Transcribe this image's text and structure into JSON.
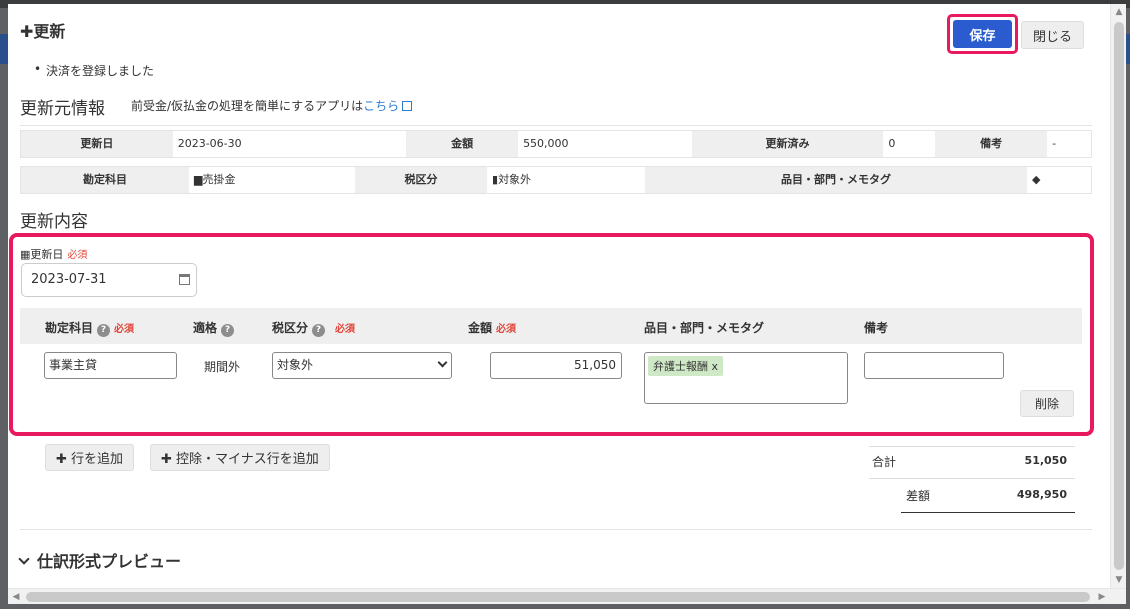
{
  "modal": {
    "title": "✚更新",
    "save_label": "保存",
    "close_label": "閉じる",
    "notice": "決済を登録しました"
  },
  "source": {
    "heading": "更新元情報",
    "promo_text": "前受金/仮払金の処理を簡単にするアプリは",
    "promo_link": "こちら",
    "row1": [
      {
        "label": "更新日",
        "value": "2023-06-30"
      },
      {
        "label": "金額",
        "value": "550,000"
      },
      {
        "label": "更新済み",
        "value": "0"
      },
      {
        "label": "備考",
        "value": "-"
      }
    ],
    "row2": [
      {
        "label": "勘定科目",
        "value": "売掛金"
      },
      {
        "label": "税区分",
        "value": "対象外"
      },
      {
        "label": "品目・部門・メモタグ",
        "value": ""
      }
    ]
  },
  "update": {
    "heading": "更新内容",
    "date_label": "更新日",
    "required": "必須",
    "date_value": "2023-07-31",
    "columns": {
      "account": "勘定科目",
      "summary": "適格",
      "tax": "税区分",
      "amount": "金額",
      "tags": "品目・部門・メモタグ",
      "memo": "備考"
    },
    "row": {
      "account": "事業主貸",
      "summary": "期間外",
      "tax": "対象外",
      "amount": "51,050",
      "tag": "弁護士報酬",
      "tag_remove": "x",
      "memo": ""
    },
    "delete_label": "削除",
    "add_row_label": "✚ 行を追加",
    "add_minus_row_label": "✚ 控除・マイナス行を追加"
  },
  "totals": {
    "sum_label": "合計",
    "sum_value": "51,050",
    "diff_label": "差額",
    "diff_value": "498,950"
  },
  "preview": {
    "heading": "仕訳形式プレビュー"
  }
}
